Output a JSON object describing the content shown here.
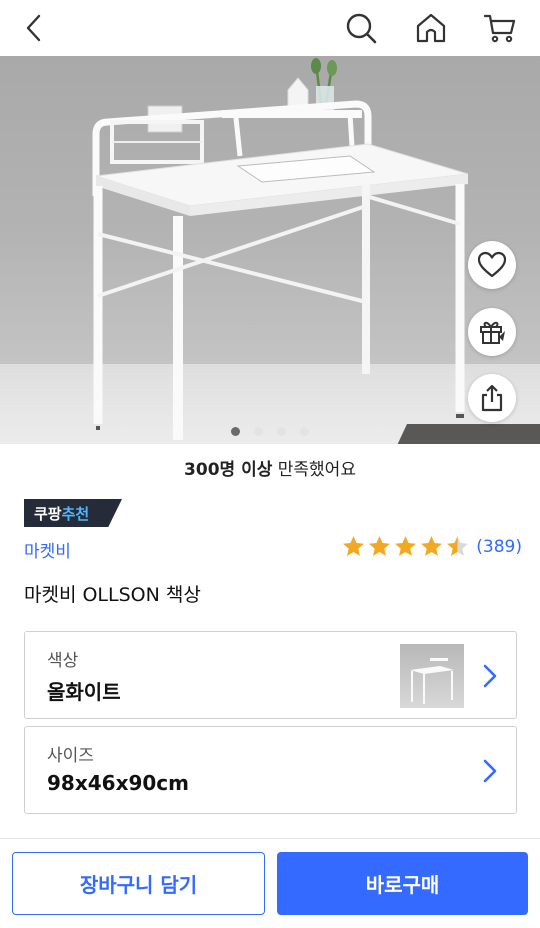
{
  "header": {
    "back_icon": "chevron-left-icon",
    "search_icon": "search-icon",
    "home_icon": "home-icon",
    "cart_icon": "cart-icon"
  },
  "gallery": {
    "image_description": "white desk product photo",
    "dots_count": 4,
    "active_dot": 0,
    "actions": [
      {
        "icon": "heart-icon"
      },
      {
        "icon": "gift-icon"
      },
      {
        "icon": "share-icon"
      }
    ]
  },
  "satisfaction": {
    "count_text": "300명 이상",
    "suffix_text": " 만족했어요"
  },
  "badge": {
    "part1": "쿠팡",
    "part2": "추천"
  },
  "product": {
    "brand": "마켓비",
    "rating": 4.5,
    "review_count": "(389)",
    "title": "마켓비 OLLSON 책상"
  },
  "options": {
    "color": {
      "label": "색상",
      "value": "올화이트"
    },
    "size": {
      "label": "사이즈",
      "value": "98x46x90cm"
    }
  },
  "actions": {
    "add_to_cart": "장바구니 담기",
    "buy_now": "바로구매"
  },
  "colors": {
    "accent": "#346aff",
    "star": "#f3a821",
    "badge_bg": "#252b38",
    "badge_highlight": "#4fb7ff"
  }
}
